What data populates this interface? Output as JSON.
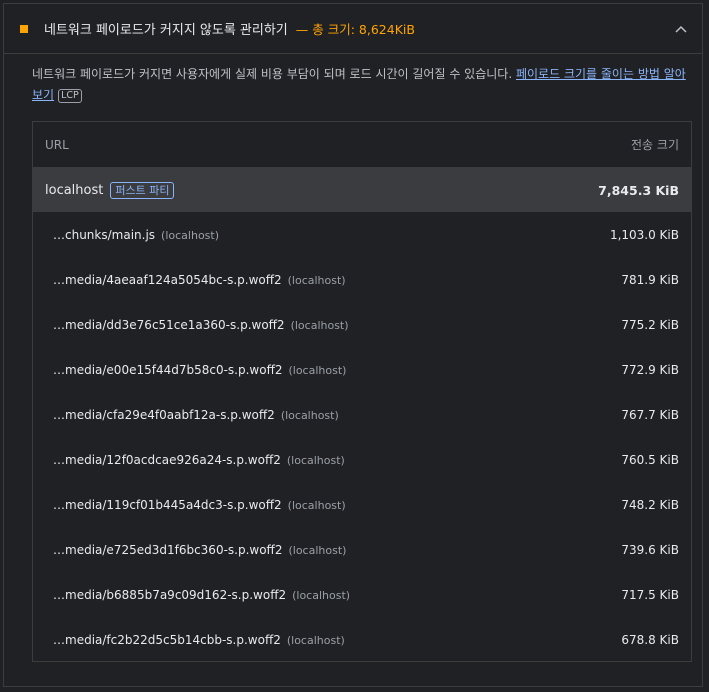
{
  "audit": {
    "title": "네트워크 페이로드가 커지지 않도록 관리하기",
    "display_value": "— 총 크기: 8,624KiB",
    "status_color": "#ffa400",
    "description_text": "네트워크 페이로드가 커지면 사용자에게 실제 비용 부담이 되며 로드 시간이 길어질 수 있습니다. ",
    "learn_more_link": "페이로드 크기를 줄이는 방법 알아보기",
    "metric_badge": "LCP"
  },
  "table": {
    "headers": {
      "url": "URL",
      "size": "전송 크기"
    },
    "entity": {
      "name": "localhost",
      "badge": "퍼스트 파티",
      "size": "7,845.3 KiB"
    },
    "rows": [
      {
        "path": "…chunks/main.js",
        "host": "(localhost)",
        "size": "1,103.0 KiB"
      },
      {
        "path": "…media/4aeaaf124a5054bc-s.p.woff2",
        "host": "(localhost)",
        "size": "781.9 KiB"
      },
      {
        "path": "…media/dd3e76c51ce1a360-s.p.woff2",
        "host": "(localhost)",
        "size": "775.2 KiB"
      },
      {
        "path": "…media/e00e15f44d7b58c0-s.p.woff2",
        "host": "(localhost)",
        "size": "772.9 KiB"
      },
      {
        "path": "…media/cfa29e4f0aabf12a-s.p.woff2",
        "host": "(localhost)",
        "size": "767.7 KiB"
      },
      {
        "path": "…media/12f0acdcae926a24-s.p.woff2",
        "host": "(localhost)",
        "size": "760.5 KiB"
      },
      {
        "path": "…media/119cf01b445a4dc3-s.p.woff2",
        "host": "(localhost)",
        "size": "748.2 KiB"
      },
      {
        "path": "…media/e725ed3d1f6bc360-s.p.woff2",
        "host": "(localhost)",
        "size": "739.6 KiB"
      },
      {
        "path": "…media/b6885b7a9c09d162-s.p.woff2",
        "host": "(localhost)",
        "size": "717.5 KiB"
      },
      {
        "path": "…media/fc2b22d5c5b14cbb-s.p.woff2",
        "host": "(localhost)",
        "size": "678.8 KiB"
      }
    ]
  },
  "icons": {
    "status": "warning-square-icon",
    "collapse": "chevron-up-icon"
  }
}
